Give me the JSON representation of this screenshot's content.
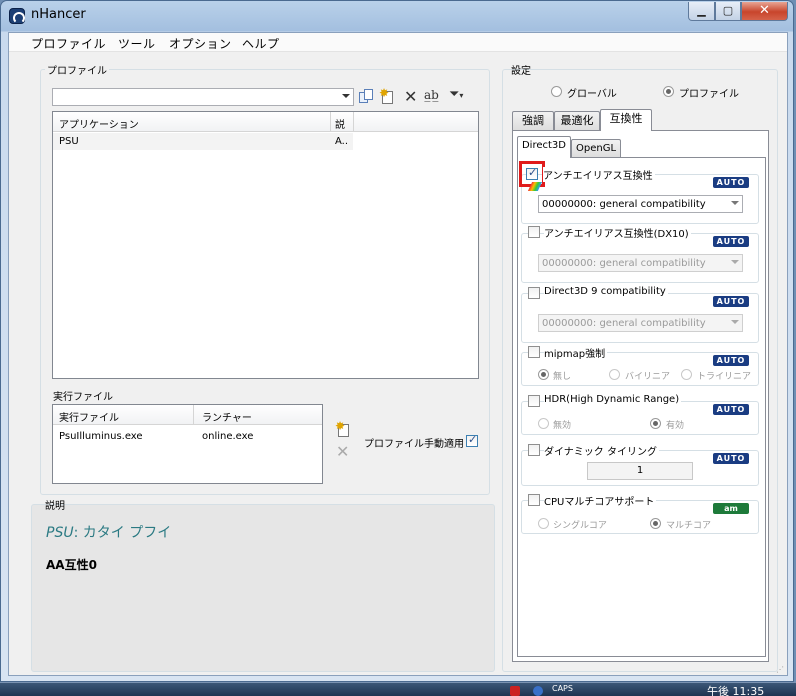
{
  "window": {
    "title": "nHancer",
    "min_icon": "minimize-icon",
    "max_icon": "maximize-icon",
    "close_icon": "close-icon"
  },
  "menubar": {
    "items": [
      "プロファイル",
      "ツール",
      "オプション",
      "ヘルプ"
    ]
  },
  "profile": {
    "group_label": "プロファイル",
    "combo_value": "",
    "columns": [
      "アプリケーション",
      "説"
    ],
    "rows": [
      {
        "app": "PSU",
        "desc": "A.."
      }
    ]
  },
  "exec": {
    "group_label": "実行ファイル",
    "columns": [
      "実行ファイル",
      "ランチャー"
    ],
    "rows": [
      {
        "file": "PsuIlluminus.exe",
        "launcher": "online.exe"
      }
    ],
    "manual_apply_label": "プロファイル手動適用",
    "manual_apply_checked": true
  },
  "desc": {
    "group_label": "説明",
    "title": "PSU",
    "title_rest": ": カタイ プフイ",
    "body": "AA互性0"
  },
  "settings": {
    "group_label": "設定",
    "scope": [
      {
        "label": "グローバル",
        "checked": false
      },
      {
        "label": "プロファイル",
        "checked": true
      }
    ],
    "tabs": [
      "強調",
      "最適化",
      "互換性"
    ],
    "subtabs": [
      "Direct3D",
      "OpenGL"
    ],
    "sections": [
      {
        "label": "アンチエイリアス互換性",
        "checked": true,
        "badge": "AUTO",
        "value": "00000000: general compatibility"
      },
      {
        "label": "アンチエイリアス互換性(DX10)",
        "checked": false,
        "badge": "AUTO",
        "value": "00000000: general compatibility"
      },
      {
        "label": "Direct3D 9 compatibility",
        "checked": false,
        "badge": "AUTO",
        "value": "00000000: general compatibility"
      },
      {
        "label": "mipmap強制",
        "checked": false,
        "badge": "AUTO",
        "options": [
          "無し",
          "バイリニア",
          "トライリニア"
        ],
        "selected": 0
      },
      {
        "label": "HDR(High Dynamic Range)",
        "checked": false,
        "badge": "AUTO",
        "options": [
          "無効",
          "有効"
        ],
        "selected": 1
      },
      {
        "label": "ダイナミック タイリング",
        "checked": false,
        "badge": "AUTO",
        "value": "1"
      },
      {
        "label": "CPUマルチコアサポート",
        "checked": false,
        "badge": "AM",
        "options": [
          "シングルコア",
          "マルチコア"
        ],
        "selected": 1
      }
    ]
  },
  "taskbar": {
    "caps": "CAPS",
    "time": "午後 11:35"
  }
}
